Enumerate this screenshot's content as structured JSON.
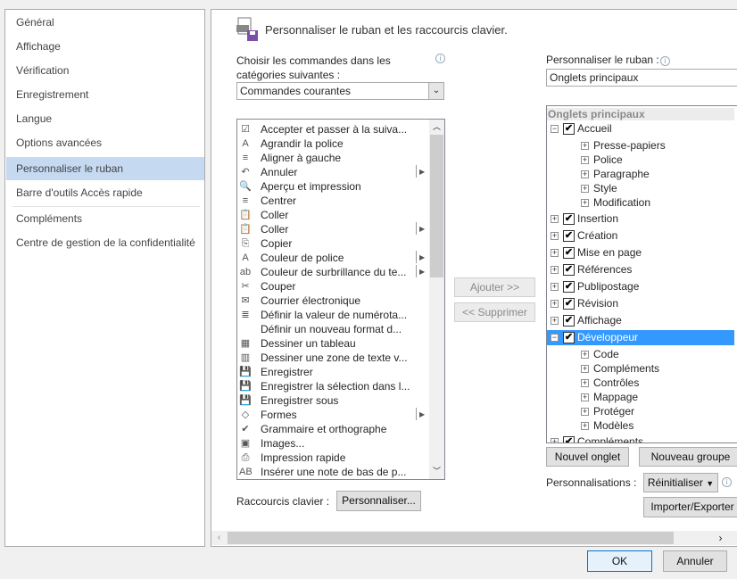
{
  "sidebar": {
    "items": [
      {
        "label": "Général"
      },
      {
        "label": "Affichage"
      },
      {
        "label": "Vérification"
      },
      {
        "label": "Enregistrement"
      },
      {
        "label": "Langue"
      },
      {
        "label": "Options avancées"
      },
      {
        "label": "Personnaliser le ruban",
        "selected": true
      },
      {
        "label": "Barre d'outils Accès rapide"
      },
      {
        "label": "Compléments"
      },
      {
        "label": "Centre de gestion de la confidentialité"
      }
    ]
  },
  "header": {
    "title": "Personnaliser le ruban et les raccourcis clavier.",
    "icon": "ribbon-customize-icon"
  },
  "left": {
    "choose_label_1": "Choisir les commandes dans les",
    "choose_label_2": "catégories suivantes :",
    "dropdown_value": "Commandes courantes",
    "commands": [
      {
        "label": "Accepter et passer à la suiva...",
        "icon": "☑",
        "sub": false
      },
      {
        "label": "Agrandir la police",
        "icon": "A",
        "sub": false
      },
      {
        "label": "Aligner à gauche",
        "icon": "≡",
        "sub": false
      },
      {
        "label": "Annuler",
        "icon": "↶",
        "sub": true
      },
      {
        "label": "Aperçu et impression",
        "icon": "🔍",
        "sub": false
      },
      {
        "label": "Centrer",
        "icon": "≡",
        "sub": false
      },
      {
        "label": "Coller",
        "icon": "📋",
        "sub": false
      },
      {
        "label": "Coller",
        "icon": "📋",
        "sub": true
      },
      {
        "label": "Copier",
        "icon": "⎘",
        "sub": false
      },
      {
        "label": "Couleur de police",
        "icon": "A",
        "sub": true
      },
      {
        "label": "Couleur de surbrillance du te...",
        "icon": "ab",
        "sub": true
      },
      {
        "label": "Couper",
        "icon": "✂",
        "sub": false
      },
      {
        "label": "Courrier électronique",
        "icon": "✉",
        "sub": false
      },
      {
        "label": "Définir la valeur de numérota...",
        "icon": "≣",
        "sub": false
      },
      {
        "label": "Définir un nouveau format d...",
        "icon": "",
        "sub": false
      },
      {
        "label": "Dessiner un tableau",
        "icon": "▦",
        "sub": false
      },
      {
        "label": "Dessiner une zone de texte v...",
        "icon": "▥",
        "sub": false
      },
      {
        "label": "Enregistrer",
        "icon": "💾",
        "sub": false
      },
      {
        "label": "Enregistrer la sélection dans l...",
        "icon": "💾",
        "sub": false
      },
      {
        "label": "Enregistrer sous",
        "icon": "💾",
        "sub": false
      },
      {
        "label": "Formes",
        "icon": "◇",
        "sub": true
      },
      {
        "label": "Grammaire et orthographe",
        "icon": "✔",
        "sub": false
      },
      {
        "label": "Images...",
        "icon": "▣",
        "sub": false
      },
      {
        "label": "Impression rapide",
        "icon": "⎙",
        "sub": false
      },
      {
        "label": "Insérer une note de bas de p...",
        "icon": "AB",
        "sub": false
      }
    ],
    "shortcuts_label": "Raccourcis clavier :",
    "customize_button": "Personnaliser..."
  },
  "middle": {
    "add_button": "Ajouter >>",
    "remove_button": "<< Supprimer"
  },
  "right": {
    "label": "Personnaliser le ruban :",
    "dropdown_value": "Onglets principaux",
    "tree_header": "Onglets principaux",
    "tree": [
      {
        "label": "Accueil",
        "level": 0,
        "expanded": true,
        "checked": true
      },
      {
        "label": "Presse-papiers",
        "level": 1
      },
      {
        "label": "Police",
        "level": 1
      },
      {
        "label": "Paragraphe",
        "level": 1
      },
      {
        "label": "Style",
        "level": 1
      },
      {
        "label": "Modification",
        "level": 1
      },
      {
        "label": "Insertion",
        "level": 0,
        "expanded": false,
        "checked": true
      },
      {
        "label": "Création",
        "level": 0,
        "expanded": false,
        "checked": true
      },
      {
        "label": "Mise en page",
        "level": 0,
        "expanded": false,
        "checked": true
      },
      {
        "label": "Références",
        "level": 0,
        "expanded": false,
        "checked": true
      },
      {
        "label": "Publipostage",
        "level": 0,
        "expanded": false,
        "checked": true
      },
      {
        "label": "Révision",
        "level": 0,
        "expanded": false,
        "checked": true
      },
      {
        "label": "Affichage",
        "level": 0,
        "expanded": false,
        "checked": true
      },
      {
        "label": "Développeur",
        "level": 0,
        "expanded": true,
        "checked": true,
        "selected": true
      },
      {
        "label": "Code",
        "level": 1
      },
      {
        "label": "Compléments",
        "level": 1
      },
      {
        "label": "Contrôles",
        "level": 1
      },
      {
        "label": "Mappage",
        "level": 1
      },
      {
        "label": "Protéger",
        "level": 1
      },
      {
        "label": "Modèles",
        "level": 1
      },
      {
        "label": "Compléments",
        "level": 0,
        "expanded": false,
        "checked": true
      }
    ],
    "new_tab_button": "Nouvel onglet",
    "new_group_button": "Nouveau groupe",
    "customizations_label": "Personnalisations :",
    "reset_button": "Réinitialiser",
    "import_export_button": "Importer/Exporter"
  },
  "footer": {
    "ok": "OK",
    "cancel": "Annuler"
  },
  "colors": {
    "selection": "#3399ff",
    "sidebar_selection": "#c5d9f1"
  }
}
